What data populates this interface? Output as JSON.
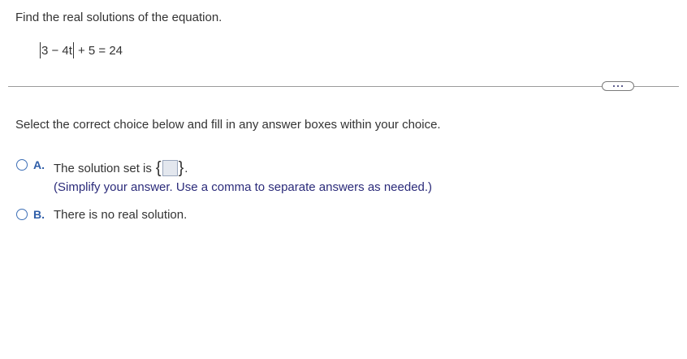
{
  "question": {
    "prompt": "Find the real solutions of the equation.",
    "equation_inner": "3 − 4t",
    "equation_rest": "+ 5 = 24"
  },
  "more_button": {
    "label": "..."
  },
  "instruction": "Select the correct choice below and fill in any answer boxes within your choice.",
  "choices": [
    {
      "letter": "A.",
      "text": "The solution set is",
      "open_brace": "{",
      "close_brace": "}",
      "period": ".",
      "hint": "(Simplify your answer. Use a comma to separate answers as needed.)",
      "answer_value": ""
    },
    {
      "letter": "B.",
      "text": "There is no real solution."
    }
  ],
  "colors": {
    "text": "#333333",
    "radio_border": "#3d6fb6",
    "choice_letter": "#2e5da8",
    "hint": "#2b2b7a",
    "answer_box_fill": "#e3e7ee",
    "divider": "#9b9b9b"
  }
}
